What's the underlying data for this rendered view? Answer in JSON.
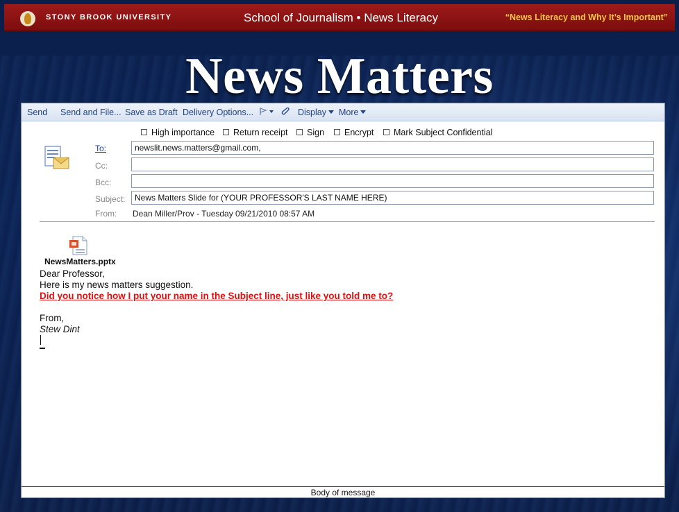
{
  "header": {
    "university": "STONY BROOK UNIVERSITY",
    "school": "School of Journalism • News Literacy",
    "tagline": "“News Literacy and Why It’s Important”"
  },
  "slide_title": "News Matters",
  "toolbar": {
    "send": "Send",
    "send_and_file": "Send and File...",
    "save_as_draft": "Save as Draft",
    "delivery_options": "Delivery Options...",
    "display": "Display",
    "more": "More"
  },
  "options": {
    "high_importance": "High importance",
    "return_receipt": "Return receipt",
    "sign": "Sign",
    "encrypt": "Encrypt",
    "mark_confidential": "Mark Subject Confidential"
  },
  "fields": {
    "to_label": "To:",
    "to_value": "newslit.news.matters@gmail.com,",
    "cc_label": "Cc:",
    "cc_value": "",
    "bcc_label": "Bcc:",
    "bcc_value": "",
    "subject_label": "Subject:",
    "subject_value": "News Matters Slide for (YOUR PROFESSOR'S LAST NAME HERE)",
    "from_label": "From:",
    "from_value": "Dean Miller/Prov - Tuesday 09/21/2010 08:57 AM"
  },
  "attachment": {
    "name": "NewsMatters.pptx"
  },
  "body": {
    "greeting": "Dear Professor,",
    "line1": "Here is my news matters suggestion.",
    "line2": "Did you notice how I put your name in the Subject line, just like you told me to?",
    "closing": "From,",
    "signature": "Stew Dint"
  },
  "status": "Body of message",
  "colors": {
    "header_red": "#8c1313",
    "tagline_gold": "#f5c44a",
    "link_blue": "#1e3f8a",
    "highlight_red": "#e01010"
  }
}
